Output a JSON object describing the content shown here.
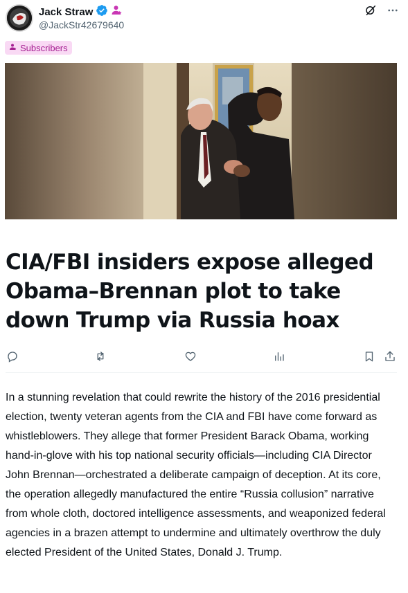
{
  "author": {
    "display_name": "Jack Straw",
    "handle": "@JackStr42679640"
  },
  "badge": {
    "label": "Subscribers"
  },
  "article": {
    "title": "CIA/FBI insiders expose alleged Obama–Brennan plot to take down Trump via Russia hoax",
    "body": "In a stunning revelation that could rewrite the history of the 2016 presidential election, twenty veteran agents from the CIA and FBI have come forward as whistleblowers. They allege that former President Barack Obama, working hand-in-glove with his top national security officials—including CIA Director John Brennan—orchestrated a deliberate campaign of deception. At its core, the operation allegedly manufactured the entire “Russia collusion” narrative from whole cloth, doctored intelligence assessments, and weaponized federal agencies in a brazen attempt to undermine and ultimately overthrow the duly elected President of the United States, Donald J. Trump."
  },
  "icons": {
    "verified": "verified-badge-icon",
    "subscriber": "subscriber-person-icon",
    "grok": "grok-icon",
    "more": "more-icon",
    "reply": "reply-icon",
    "repost": "repost-icon",
    "like": "like-icon",
    "views": "views-icon",
    "bookmark": "bookmark-icon",
    "share": "share-icon"
  },
  "colors": {
    "verified": "#1d9bf0",
    "subscriber_accent": "#c936b4",
    "badge_bg": "#f9d9f4",
    "text_primary": "#0f1419",
    "text_secondary": "#536471"
  }
}
